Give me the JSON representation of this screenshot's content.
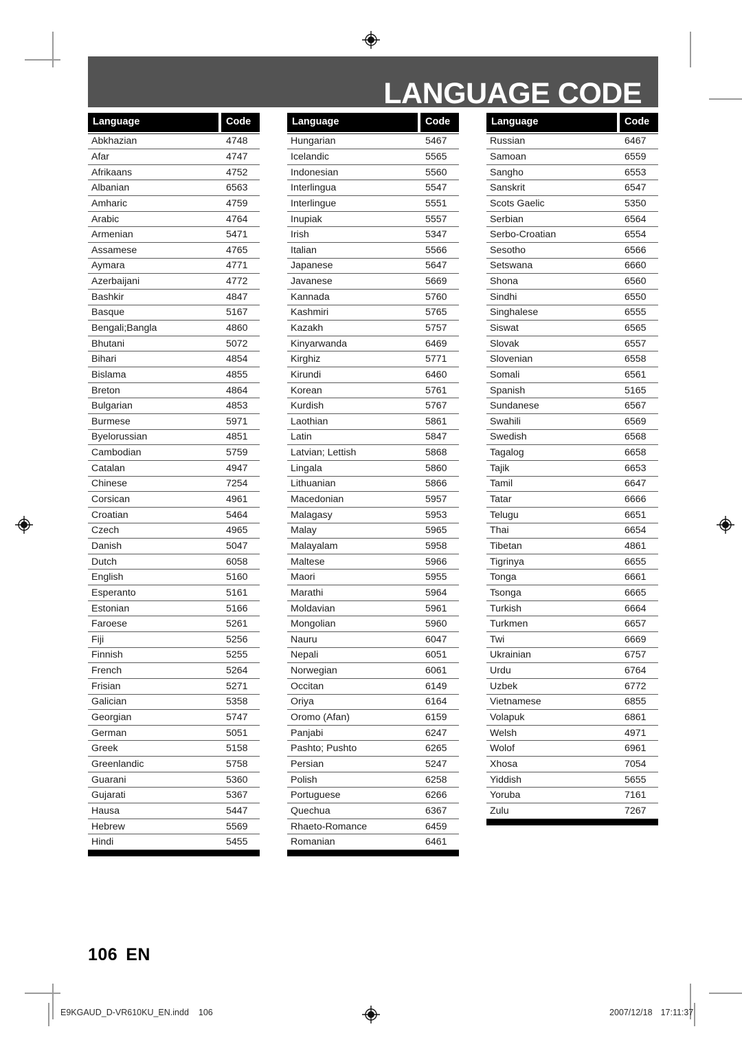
{
  "document": {
    "title": "LANGUAGE CODE",
    "page_number": "106",
    "page_language": "EN"
  },
  "table": {
    "header_language": "Language",
    "header_code": "Code",
    "columns": [
      {
        "rows": [
          {
            "language": "Abkhazian",
            "code": "4748"
          },
          {
            "language": "Afar",
            "code": "4747"
          },
          {
            "language": "Afrikaans",
            "code": "4752"
          },
          {
            "language": "Albanian",
            "code": "6563"
          },
          {
            "language": "Amharic",
            "code": "4759"
          },
          {
            "language": "Arabic",
            "code": "4764"
          },
          {
            "language": "Armenian",
            "code": "5471"
          },
          {
            "language": "Assamese",
            "code": "4765"
          },
          {
            "language": "Aymara",
            "code": "4771"
          },
          {
            "language": "Azerbaijani",
            "code": "4772"
          },
          {
            "language": "Bashkir",
            "code": "4847"
          },
          {
            "language": "Basque",
            "code": "5167"
          },
          {
            "language": "Bengali;Bangla",
            "code": "4860"
          },
          {
            "language": "Bhutani",
            "code": "5072"
          },
          {
            "language": "Bihari",
            "code": "4854"
          },
          {
            "language": "Bislama",
            "code": "4855"
          },
          {
            "language": "Breton",
            "code": "4864"
          },
          {
            "language": "Bulgarian",
            "code": "4853"
          },
          {
            "language": "Burmese",
            "code": "5971"
          },
          {
            "language": "Byelorussian",
            "code": "4851"
          },
          {
            "language": "Cambodian",
            "code": "5759"
          },
          {
            "language": "Catalan",
            "code": "4947"
          },
          {
            "language": "Chinese",
            "code": "7254"
          },
          {
            "language": "Corsican",
            "code": "4961"
          },
          {
            "language": "Croatian",
            "code": "5464"
          },
          {
            "language": "Czech",
            "code": "4965"
          },
          {
            "language": "Danish",
            "code": "5047"
          },
          {
            "language": "Dutch",
            "code": "6058"
          },
          {
            "language": "English",
            "code": "5160"
          },
          {
            "language": "Esperanto",
            "code": "5161"
          },
          {
            "language": "Estonian",
            "code": "5166"
          },
          {
            "language": "Faroese",
            "code": "5261"
          },
          {
            "language": "Fiji",
            "code": "5256"
          },
          {
            "language": "Finnish",
            "code": "5255"
          },
          {
            "language": "French",
            "code": "5264"
          },
          {
            "language": "Frisian",
            "code": "5271"
          },
          {
            "language": "Galician",
            "code": "5358"
          },
          {
            "language": "Georgian",
            "code": "5747"
          },
          {
            "language": "German",
            "code": "5051"
          },
          {
            "language": "Greek",
            "code": "5158"
          },
          {
            "language": "Greenlandic",
            "code": "5758"
          },
          {
            "language": "Guarani",
            "code": "5360"
          },
          {
            "language": "Gujarati",
            "code": "5367"
          },
          {
            "language": "Hausa",
            "code": "5447"
          },
          {
            "language": "Hebrew",
            "code": "5569"
          },
          {
            "language": "Hindi",
            "code": "5455"
          }
        ]
      },
      {
        "rows": [
          {
            "language": "Hungarian",
            "code": "5467"
          },
          {
            "language": "Icelandic",
            "code": "5565"
          },
          {
            "language": "Indonesian",
            "code": "5560"
          },
          {
            "language": "Interlingua",
            "code": "5547"
          },
          {
            "language": "Interlingue",
            "code": "5551"
          },
          {
            "language": "Inupiak",
            "code": "5557"
          },
          {
            "language": "Irish",
            "code": "5347"
          },
          {
            "language": "Italian",
            "code": "5566"
          },
          {
            "language": "Japanese",
            "code": "5647"
          },
          {
            "language": "Javanese",
            "code": "5669"
          },
          {
            "language": "Kannada",
            "code": "5760"
          },
          {
            "language": "Kashmiri",
            "code": "5765"
          },
          {
            "language": "Kazakh",
            "code": "5757"
          },
          {
            "language": "Kinyarwanda",
            "code": "6469"
          },
          {
            "language": "Kirghiz",
            "code": "5771"
          },
          {
            "language": "Kirundi",
            "code": "6460"
          },
          {
            "language": "Korean",
            "code": "5761"
          },
          {
            "language": "Kurdish",
            "code": "5767"
          },
          {
            "language": "Laothian",
            "code": "5861"
          },
          {
            "language": "Latin",
            "code": "5847"
          },
          {
            "language": "Latvian; Lettish",
            "code": "5868"
          },
          {
            "language": "Lingala",
            "code": "5860"
          },
          {
            "language": "Lithuanian",
            "code": "5866"
          },
          {
            "language": "Macedonian",
            "code": "5957"
          },
          {
            "language": "Malagasy",
            "code": "5953"
          },
          {
            "language": "Malay",
            "code": "5965"
          },
          {
            "language": "Malayalam",
            "code": "5958"
          },
          {
            "language": "Maltese",
            "code": "5966"
          },
          {
            "language": "Maori",
            "code": "5955"
          },
          {
            "language": "Marathi",
            "code": "5964"
          },
          {
            "language": "Moldavian",
            "code": "5961"
          },
          {
            "language": "Mongolian",
            "code": "5960"
          },
          {
            "language": "Nauru",
            "code": "6047"
          },
          {
            "language": "Nepali",
            "code": "6051"
          },
          {
            "language": "Norwegian",
            "code": "6061"
          },
          {
            "language": "Occitan",
            "code": "6149"
          },
          {
            "language": "Oriya",
            "code": "6164"
          },
          {
            "language": "Oromo (Afan)",
            "code": "6159"
          },
          {
            "language": "Panjabi",
            "code": "6247"
          },
          {
            "language": "Pashto; Pushto",
            "code": "6265"
          },
          {
            "language": "Persian",
            "code": "5247"
          },
          {
            "language": "Polish",
            "code": "6258"
          },
          {
            "language": "Portuguese",
            "code": "6266"
          },
          {
            "language": "Quechua",
            "code": "6367"
          },
          {
            "language": "Rhaeto-Romance",
            "code": "6459"
          },
          {
            "language": "Romanian",
            "code": "6461"
          }
        ]
      },
      {
        "rows": [
          {
            "language": "Russian",
            "code": "6467"
          },
          {
            "language": "Samoan",
            "code": "6559"
          },
          {
            "language": "Sangho",
            "code": "6553"
          },
          {
            "language": "Sanskrit",
            "code": "6547"
          },
          {
            "language": "Scots Gaelic",
            "code": "5350"
          },
          {
            "language": "Serbian",
            "code": "6564"
          },
          {
            "language": "Serbo-Croatian",
            "code": "6554"
          },
          {
            "language": "Sesotho",
            "code": "6566"
          },
          {
            "language": "Setswana",
            "code": "6660"
          },
          {
            "language": "Shona",
            "code": "6560"
          },
          {
            "language": "Sindhi",
            "code": "6550"
          },
          {
            "language": "Singhalese",
            "code": "6555"
          },
          {
            "language": "Siswat",
            "code": "6565"
          },
          {
            "language": "Slovak",
            "code": "6557"
          },
          {
            "language": "Slovenian",
            "code": "6558"
          },
          {
            "language": "Somali",
            "code": "6561"
          },
          {
            "language": "Spanish",
            "code": "5165"
          },
          {
            "language": "Sundanese",
            "code": "6567"
          },
          {
            "language": "Swahili",
            "code": "6569"
          },
          {
            "language": "Swedish",
            "code": "6568"
          },
          {
            "language": "Tagalog",
            "code": "6658"
          },
          {
            "language": "Tajik",
            "code": "6653"
          },
          {
            "language": "Tamil",
            "code": "6647"
          },
          {
            "language": "Tatar",
            "code": "6666"
          },
          {
            "language": "Telugu",
            "code": "6651"
          },
          {
            "language": "Thai",
            "code": "6654"
          },
          {
            "language": "Tibetan",
            "code": "4861"
          },
          {
            "language": "Tigrinya",
            "code": "6655"
          },
          {
            "language": "Tonga",
            "code": "6661"
          },
          {
            "language": "Tsonga",
            "code": "6665"
          },
          {
            "language": "Turkish",
            "code": "6664"
          },
          {
            "language": "Turkmen",
            "code": "6657"
          },
          {
            "language": "Twi",
            "code": "6669"
          },
          {
            "language": "Ukrainian",
            "code": "6757"
          },
          {
            "language": "Urdu",
            "code": "6764"
          },
          {
            "language": "Uzbek",
            "code": "6772"
          },
          {
            "language": "Vietnamese",
            "code": "6855"
          },
          {
            "language": "Volapuk",
            "code": "6861"
          },
          {
            "language": "Welsh",
            "code": "4971"
          },
          {
            "language": "Wolof",
            "code": "6961"
          },
          {
            "language": "Xhosa",
            "code": "7054"
          },
          {
            "language": "Yiddish",
            "code": "5655"
          },
          {
            "language": "Yoruba",
            "code": "7161"
          },
          {
            "language": "Zulu",
            "code": "7267"
          }
        ]
      }
    ]
  },
  "print_footer": {
    "filename": "E9KGAUD_D-VR610KU_EN.indd",
    "page": "106",
    "date": "2007/12/18",
    "time": "17:11:37"
  },
  "colors": {
    "banner": "#535353",
    "header_block": "#000000",
    "rule": "#5a5a5a",
    "crop_mark": "#9a9a9a"
  }
}
